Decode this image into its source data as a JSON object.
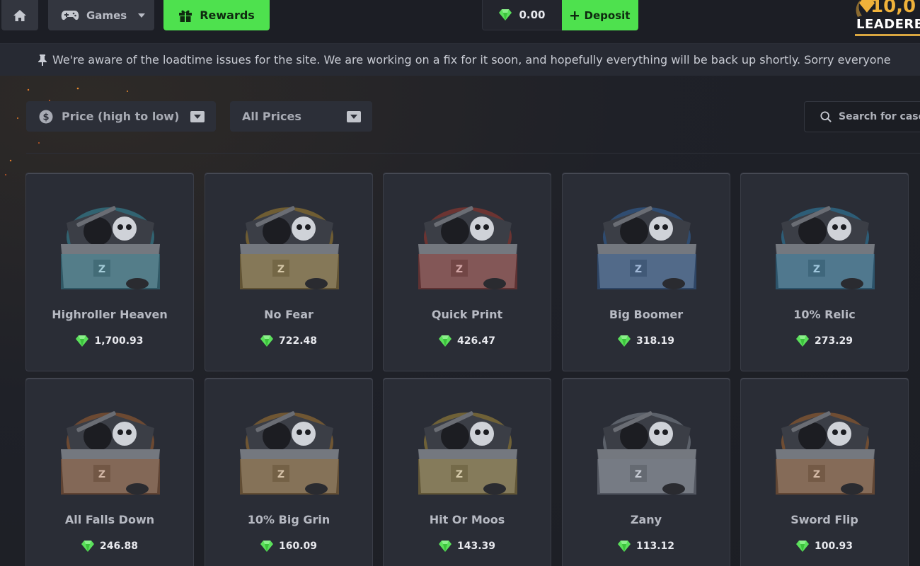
{
  "topbar": {
    "games_label": "Games",
    "rewards_label": "Rewards",
    "balance": "0.00",
    "deposit_label": "Deposit",
    "leaderboard_amount": "10,0",
    "leaderboard_label": "LEADERB"
  },
  "announcement": {
    "text": "We're aware of the loadtime issues for the site. We are working on a fix for it soon, and hopefully everything will be back up shortly. Sorry everyone"
  },
  "filters": {
    "sort_label": "Price (high to low)",
    "price_filter_label": "All Prices",
    "search_placeholder": "Search for cases"
  },
  "colors": {
    "accent_green": "#4ee14e",
    "gem_green": "#5be05b",
    "leaderboard_gold": "#f0b23a"
  },
  "cases": [
    {
      "name": "Highroller Heaven",
      "price": "1,700.93",
      "theme": "#3fc8e0"
    },
    {
      "name": "No Fear",
      "price": "722.48",
      "theme": "#f2b62d"
    },
    {
      "name": "Quick Print",
      "price": "426.47",
      "theme": "#e8412b"
    },
    {
      "name": "Big Boomer",
      "price": "318.19",
      "theme": "#3a86e0"
    },
    {
      "name": "10% Relic",
      "price": "273.29",
      "theme": "#33b6f0"
    },
    {
      "name": "All Falls Down",
      "price": "246.88",
      "theme": "#e87d2b"
    },
    {
      "name": "10% Big Grin",
      "price": "160.09",
      "theme": "#f2a22d"
    },
    {
      "name": "Hit Or Moos",
      "price": "143.39",
      "theme": "#f0c23a"
    },
    {
      "name": "Zany",
      "price": "113.12",
      "theme": "#b9c2cc"
    },
    {
      "name": "Sword Flip",
      "price": "100.93",
      "theme": "#f28a2d"
    }
  ]
}
